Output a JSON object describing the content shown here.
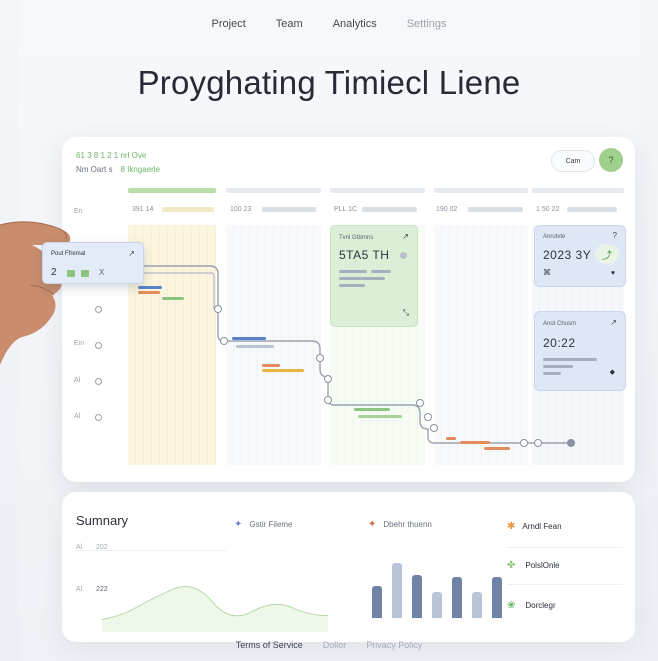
{
  "nav": {
    "items": [
      "Project",
      "Team",
      "Analytics",
      "Settings"
    ]
  },
  "hero": {
    "title": "Proyghating Timiecl Liene"
  },
  "card": {
    "head_a": "61 3 8 1 2 1 nrl Ove",
    "head_b": "Nm Oart s",
    "head_b_green": "8 Ikngaerle",
    "claim_label": "Cam",
    "help_label": "?",
    "columns": [
      "391 14",
      "100 23",
      "PLL 1C",
      "190 02",
      "1 50 22"
    ],
    "rows": [
      "En",
      "Ein",
      "Al",
      "Al"
    ]
  },
  "hand_card": {
    "title": "Pout Ffremal",
    "value": "2",
    "suffix": "X",
    "arrow": "↗"
  },
  "panel_green": {
    "caption": "Tvnl Gtbrnns",
    "value": "5TA5 TH",
    "icon": "↗",
    "corner": "⤡"
  },
  "panel_blue_1": {
    "caption": "Anrutvte",
    "value": "2023 3Y",
    "icon": "?",
    "x_mark": "⌘"
  },
  "panel_blue_2": {
    "caption": "Anot Chusm",
    "value": "20:22",
    "icon": "↗"
  },
  "summary": {
    "title": "Sumnary",
    "legend": [
      "Gstir Fileme",
      "Dbehr thuenn",
      "Arndl Fean"
    ],
    "ylabels": [
      "Al",
      "202",
      "Al",
      "222"
    ],
    "list": [
      "PolslOnle",
      "Dorclegr"
    ],
    "bars": [
      0.55,
      0.95,
      0.75,
      0.45,
      0.7,
      0.45,
      0.7
    ]
  },
  "footer": {
    "items": [
      "Terms of Service",
      "Dollor",
      "Privacy Policy"
    ]
  },
  "colors": {
    "green_accent": "#9fd08e",
    "blue_panel": "#dfe7f6",
    "bar_dark": "#6f83a6",
    "bar_light": "#b8c4d8"
  }
}
